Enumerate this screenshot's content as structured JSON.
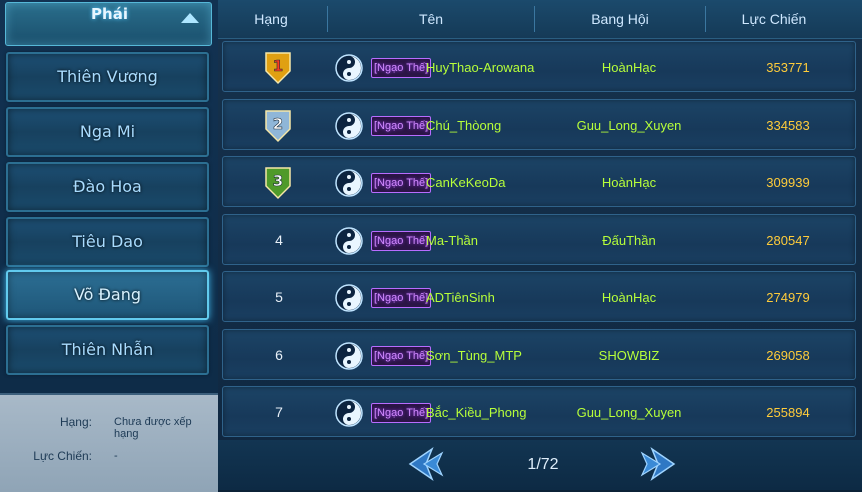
{
  "sidebar": {
    "header": "Phái",
    "items": [
      {
        "label": "Thiên Vương",
        "active": false
      },
      {
        "label": "Nga Mi",
        "active": false
      },
      {
        "label": "Đào Hoa",
        "active": false
      },
      {
        "label": "Tiêu Dao",
        "active": false
      },
      {
        "label": "Võ Đang",
        "active": true
      },
      {
        "label": "Thiên Nhẫn",
        "active": false
      }
    ],
    "info": {
      "rank_label": "Hạng:",
      "rank_value": "Chưa được xếp hạng",
      "power_label": "Lực Chiến:",
      "power_value": "-"
    }
  },
  "table": {
    "headers": {
      "rank": "Hạng",
      "name": "Tên",
      "guild": "Bang Hội",
      "power": "Lực Chiến"
    },
    "rows": [
      {
        "rank": "1",
        "tag": "[Ngạo Thế]",
        "name": "HuyThao-Arowana",
        "guild": "HoànHạc",
        "power": "353771"
      },
      {
        "rank": "2",
        "tag": "[Ngạo Thế]",
        "name": "Chú_Thòong",
        "guild": "Guu_Long_Xuyen",
        "power": "334583"
      },
      {
        "rank": "3",
        "tag": "[Ngạo Thế]",
        "name": "CanKeKeoDa",
        "guild": "HoànHạc",
        "power": "309939"
      },
      {
        "rank": "4",
        "tag": "[Ngạo Thế]",
        "name": "Ma-Thần",
        "guild": "ĐấuThần",
        "power": "280547"
      },
      {
        "rank": "5",
        "tag": "[Ngạo Thế]",
        "name": "ADTiênSinh",
        "guild": "HoànHạc",
        "power": "274979"
      },
      {
        "rank": "6",
        "tag": "[Ngạo Thế]",
        "name": "Sơn_Tùng_MTP",
        "guild": "SHOWBIZ",
        "power": "269058"
      },
      {
        "rank": "7",
        "tag": "[Ngạo Thế]",
        "name": "Bắc_Kiều_Phong",
        "guild": "Guu_Long_Xuyen",
        "power": "255894"
      }
    ]
  },
  "pagination": {
    "page": "1/72"
  },
  "colors": {
    "name": "#b7ff3a",
    "power": "#ffcc3a",
    "tag": "#d28bff",
    "medal_1": "#e0a012",
    "medal_2": "#8fb6d8",
    "medal_3": "#4f9a2a"
  }
}
